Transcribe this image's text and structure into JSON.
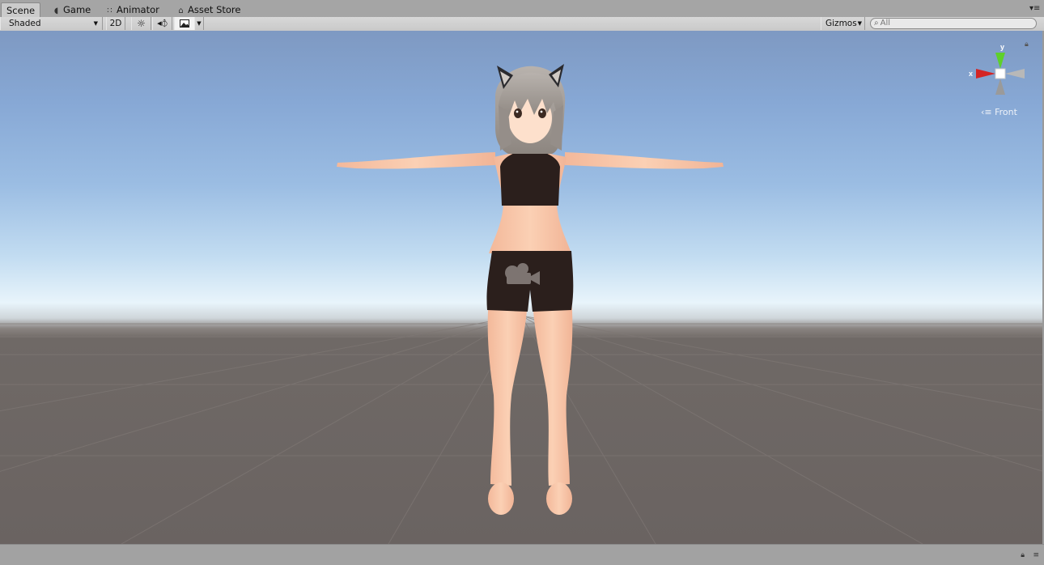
{
  "tabs": [
    {
      "label": "Scene",
      "icon": "scene-icon",
      "active": true
    },
    {
      "label": "Game",
      "icon": "game-controller-icon",
      "active": false
    },
    {
      "label": "Animator",
      "icon": "animator-icon",
      "active": false
    },
    {
      "label": "Asset Store",
      "icon": "shopping-bag-icon",
      "active": false
    }
  ],
  "toolbar": {
    "shading_mode": "Shaded",
    "mode_2d": "2D",
    "gizmos": "Gizmos",
    "search_placeholder": "All"
  },
  "viewport": {
    "gizmo_axis_y": "y",
    "gizmo_axis_x": "x",
    "view_label": "Front"
  },
  "colors": {
    "axis_x": "#d42424",
    "axis_y": "#5ed02a",
    "sky_top": "#7e99c2",
    "horizon": "#e8f4fb",
    "ground": "#6a6361",
    "skin": "#f9c7a7",
    "outfit": "#2b1f1c",
    "hair": "#a09a96"
  }
}
